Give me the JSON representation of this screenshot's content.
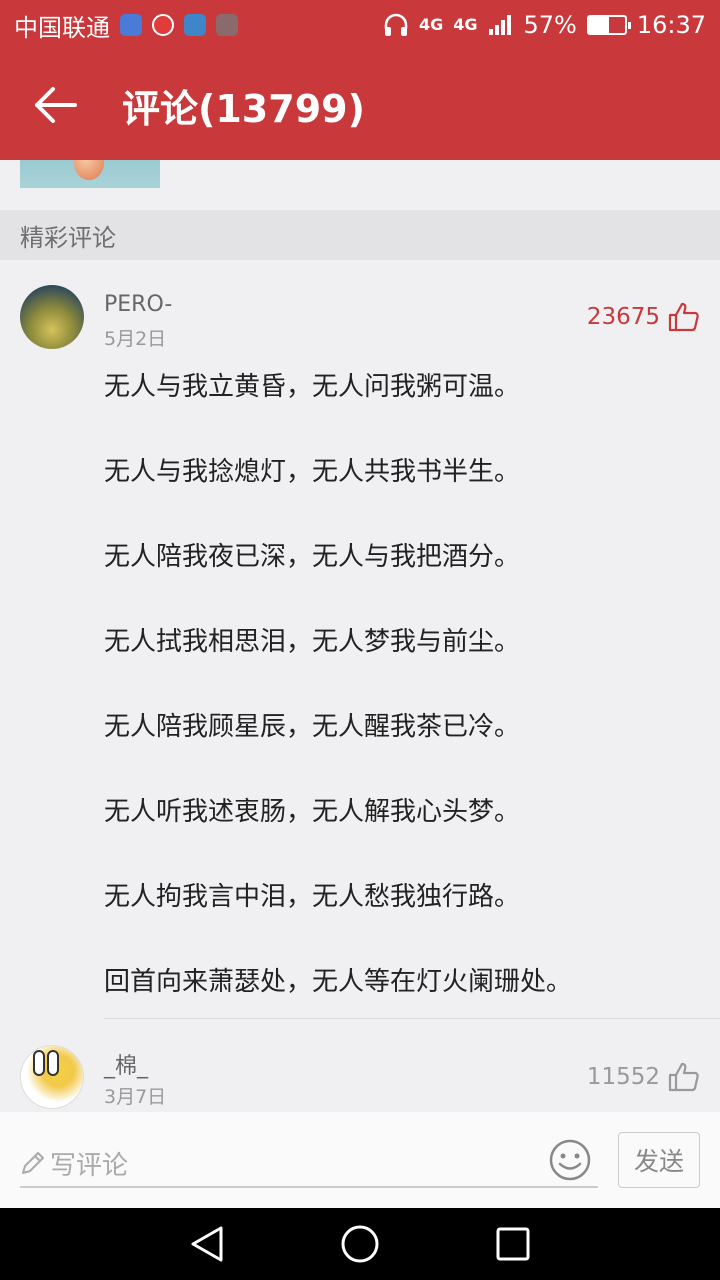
{
  "status_bar": {
    "carrier": "中国联通",
    "network": "4G",
    "network2": "4G",
    "battery": "57%",
    "battery_level": 0.57,
    "time": "16:37"
  },
  "header": {
    "title": "评论(13799)",
    "back_icon": "arrow-left-icon",
    "background_color": "#c9393c"
  },
  "section": {
    "label": "精彩评论"
  },
  "comments": [
    {
      "username": "PERO-",
      "date": "5月2日",
      "likes": "23675",
      "liked": true,
      "lines": [
        "无人与我立黄昏，无人问我粥可温。",
        "无人与我捻熄灯，无人共我书半生。",
        "无人陪我夜已深，无人与我把酒分。",
        "无人拭我相思泪，无人梦我与前尘。",
        "无人陪我顾星辰，无人醒我茶已冷。",
        "无人听我述衷肠，无人解我心头梦。",
        "无人拘我言中泪，无人愁我独行路。",
        "回首向来萧瑟处，无人等在灯火阑珊处。"
      ]
    },
    {
      "username": "_棉_",
      "date": "3月7日",
      "likes": "11552",
      "liked": false
    }
  ],
  "input_bar": {
    "placeholder": "写评论",
    "send_label": "发送"
  },
  "colors": {
    "accent": "#c9393c",
    "liked": "#c9393c",
    "muted": "#999999"
  }
}
